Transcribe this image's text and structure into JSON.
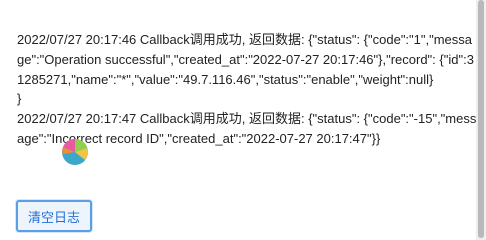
{
  "log": {
    "entry1": {
      "text": "2022/07/27 20:17:46 Callback调用成功, 返回数据: {\"status\": {\"code\":\"1\",\"message\":\"Operation successful\",\"created_at\":\"2022-07-27 20:17:46\"},\"record\": {\"id\":31285271,\"name\":\"*\",\"value\":\"49.7.116.46\",\"status\":\"enable\",\"weight\":null}",
      "closer": "}"
    },
    "entry2": {
      "text": "2022/07/27 20:17:47 Callback调用成功, 返回数据: {\"status\": {\"code\":\"-15\",\"message\":\"Incorrect record ID\",\"created_at\":\"2022-07-27 20:17:47\"}}"
    }
  },
  "actions": {
    "clear_label": "清空日志"
  },
  "colors": {
    "accent": "#5b9ee8",
    "button_text": "#1f6fd6",
    "text": "#222222"
  },
  "icons": {
    "overlay": "busy-cursor-icon"
  }
}
